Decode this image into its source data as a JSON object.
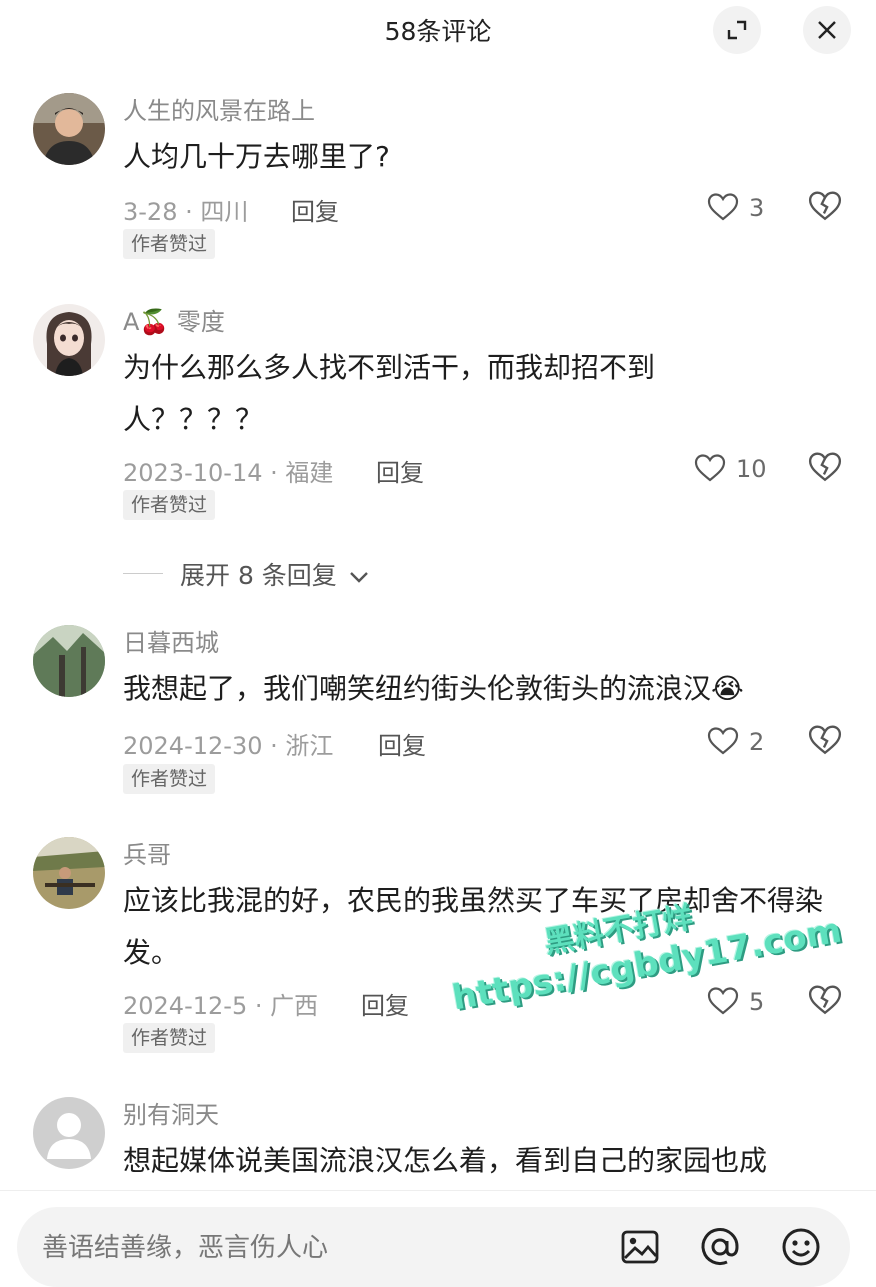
{
  "header": {
    "title": "58条评论"
  },
  "comments": [
    {
      "username": "人生的风景在路上",
      "text": "人均几十万去哪里了?",
      "meta": "3-28 · 四川",
      "reply": "回复",
      "likes": "3",
      "badge": "作者赞过"
    },
    {
      "username": "A🍒 零度",
      "text": "为什么那么多人找不到活干，而我却招不到人？？？？",
      "meta": "2023-10-14 · 福建",
      "reply": "回复",
      "likes": "10",
      "badge": "作者赞过"
    },
    {
      "username": "日暮西城",
      "text": "我想起了，我们嘲笑纽约街头伦敦街头的流浪汉😭",
      "meta": "2024-12-30 · 浙江",
      "reply": "回复",
      "likes": "2",
      "badge": "作者赞过"
    },
    {
      "username": "兵哥",
      "text": "应该比我混的好，农民的我虽然买了车买了房却舍不得染发。",
      "meta": "2024-12-5 · 广西",
      "reply": "回复",
      "likes": "5",
      "badge": "作者赞过"
    },
    {
      "username": "别有洞天",
      "text": "想起媒体说美国流浪汉怎么着，看到自己的家园也成"
    }
  ],
  "expand_replies": "展开 8 条回复",
  "watermark": {
    "line1": "黑料不打烊",
    "line2": "https://cgbdy17.com"
  },
  "input": {
    "placeholder": "善语结善缘，恶言伤人心"
  },
  "icons": {
    "expand": "expand-icon",
    "close": "close-icon",
    "like": "heart-icon",
    "dislike": "broken-heart-icon",
    "image": "image-icon",
    "mention": "at-icon",
    "emoji": "emoji-icon"
  }
}
